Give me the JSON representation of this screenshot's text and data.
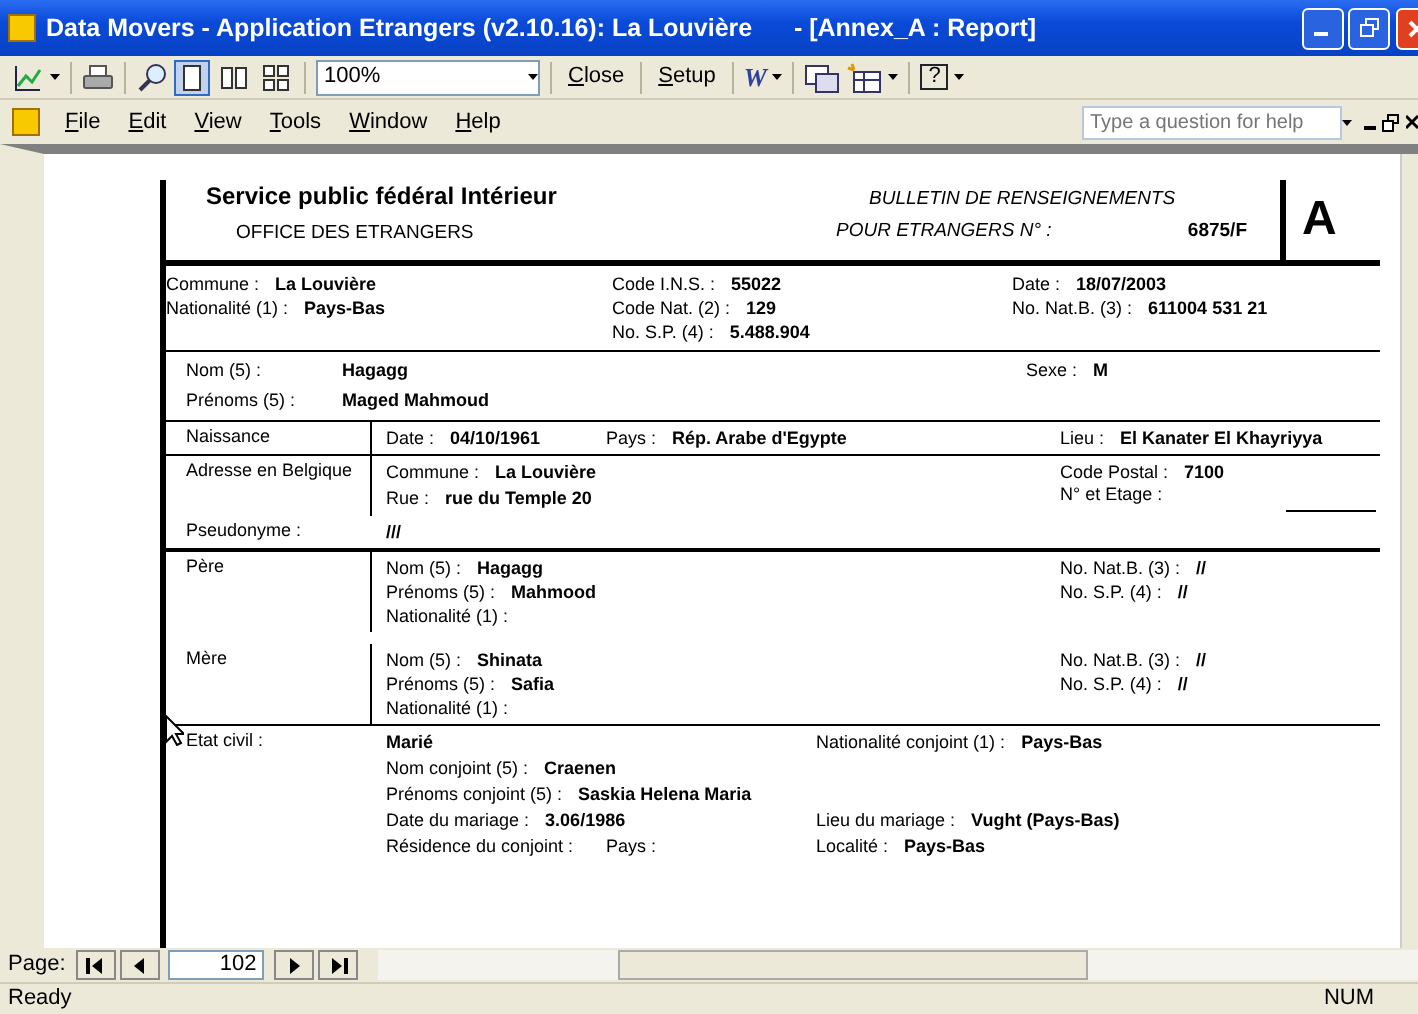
{
  "window": {
    "title": "Data Movers - Application Etrangers (v2.10.16): La Louvière      - [Annex_A : Report]"
  },
  "toolbar": {
    "zoom": "100%",
    "buttons": [
      "Close",
      "Setup"
    ],
    "word_glyph": "W",
    "help_glyph": "?",
    "view_modes": [
      {
        "kind": "one",
        "selected": true
      },
      {
        "kind": "two",
        "selected": false
      },
      {
        "kind": "multi",
        "selected": false
      }
    ]
  },
  "menu": [
    "File",
    "Edit",
    "View",
    "Tools",
    "Window",
    "Help"
  ],
  "help_box": {
    "placeholder": "Type a question for help"
  },
  "report": {
    "header": {
      "org": "Service public fédéral Intérieur",
      "office": "OFFICE DES ETRANGERS",
      "bulletin": "BULLETIN DE RENSEIGNEMENTS",
      "number_label": "POUR ETRANGERS N° :",
      "number": "6875/F",
      "letter": "A"
    },
    "sections": [
      {
        "kind": "info",
        "blocks": [
          {
            "rows": [
              [
                {
                  "label": "Commune :",
                  "value": "La Louvière"
                },
                {
                  "label": "Code I.N.S. :",
                  "value": "55022"
                },
                {
                  "label": "Date :",
                  "value": "18/07/2003"
                }
              ],
              [
                {
                  "label": "Nationalité (1) :",
                  "value": "Pays-Bas"
                },
                {
                  "label": "Code Nat. (2) :",
                  "value": "129"
                },
                {
                  "label": "No. Nat.B. (3) :",
                  "value": "611004 531 21"
                }
              ],
              [
                "",
                {
                  "label": "No. S.P. (4) :",
                  "value": "5.488.904"
                }
              ]
            ]
          }
        ]
      },
      {
        "kind": "person",
        "blocks": [
          {
            "rows": [
              [
                {
                  "label": "Nom (5) :",
                  "value": "Hagagg"
                },
                {
                  "label": "Sexe :",
                  "value": "M"
                }
              ],
              [
                {
                  "label": "Prénoms (5) :",
                  "value": "Maged Mahmoud"
                }
              ]
            ]
          }
        ]
      },
      {
        "kind": "birth",
        "blocks": [
          {
            "heading": "Naissance",
            "rows": [
              [
                {
                  "label": "Date :",
                  "value": "04/10/1961"
                },
                {
                  "label": "Pays :",
                  "value": "Rép. Arabe d'Egypte"
                },
                {
                  "label": "Lieu :",
                  "value": "El Kanater El Khayriyya"
                }
              ]
            ]
          }
        ]
      },
      {
        "kind": "address",
        "blocks": [
          {
            "heading": "Adresse en Belgique",
            "rows": [
              [
                {
                  "label": "Commune :",
                  "value": "La Louvière"
                },
                "",
                {
                  "label": "Code Postal :",
                  "value": "7100"
                }
              ],
              [
                {
                  "label": "Rue :",
                  "value": "rue du Temple 20"
                },
                "",
                {
                  "label": "N° et Etage :",
                  "kind": "line"
                }
              ]
            ]
          }
        ]
      },
      {
        "kind": "pseudonym",
        "blocks": [
          {
            "heading": "Pseudonyme :",
            "rows": [
              [
                {
                  "value": "///"
                }
              ]
            ]
          }
        ]
      },
      {
        "kind": "parents",
        "blocks": [
          {
            "heading": "Père",
            "rows": [
              [
                {
                  "label": "Nom (5) :",
                  "value": "Hagagg"
                },
                "",
                {
                  "label": "No. Nat.B. (3) :",
                  "value": "//"
                }
              ],
              [
                {
                  "label": "Prénoms (5) :",
                  "value": "Mahmood"
                },
                "",
                {
                  "label": "No. S.P. (4) :",
                  "value": "//"
                }
              ],
              [
                {
                  "label": "Nationalité (1) :"
                }
              ]
            ]
          },
          {
            "heading": "Mère",
            "rows": [
              [
                {
                  "label": "Nom (5) :",
                  "value": "Shinata"
                },
                "",
                {
                  "label": "No. Nat.B. (3) :",
                  "value": "//"
                }
              ],
              [
                {
                  "label": "Prénoms (5) :",
                  "value": "Safia"
                },
                "",
                {
                  "label": "No. S.P. (4) :",
                  "value": "//"
                }
              ],
              [
                {
                  "label": "Nationalité (1) :"
                }
              ]
            ]
          }
        ]
      },
      {
        "kind": "civil",
        "blocks": [
          {
            "heading": "Etat civil :",
            "rows": [
              [
                {
                  "value": "Marié"
                },
                "",
                {
                  "label": "Nationalité conjoint (1) :",
                  "value": "Pays-Bas"
                }
              ],
              [
                {
                  "label": "Nom conjoint (5) :",
                  "value": "Craenen"
                }
              ],
              [
                {
                  "label": "Prénoms conjoint (5) :",
                  "value": "Saskia Helena Maria"
                }
              ],
              [
                {
                  "label": "Date du mariage :",
                  "value": "3.06/1986"
                },
                "",
                {
                  "label": "Lieu du mariage :",
                  "value": "Vught (Pays-Bas)"
                }
              ],
              [
                {
                  "label": "Résidence du conjoint :"
                },
                {
                  "label": "Pays :"
                },
                {
                  "label": "Localité :",
                  "value": "Pays-Bas"
                }
              ]
            ]
          }
        ]
      }
    ]
  },
  "pager": {
    "label": "Page:",
    "page": "102"
  },
  "status_bar": {
    "text": "Ready",
    "indicator": "NUM"
  }
}
